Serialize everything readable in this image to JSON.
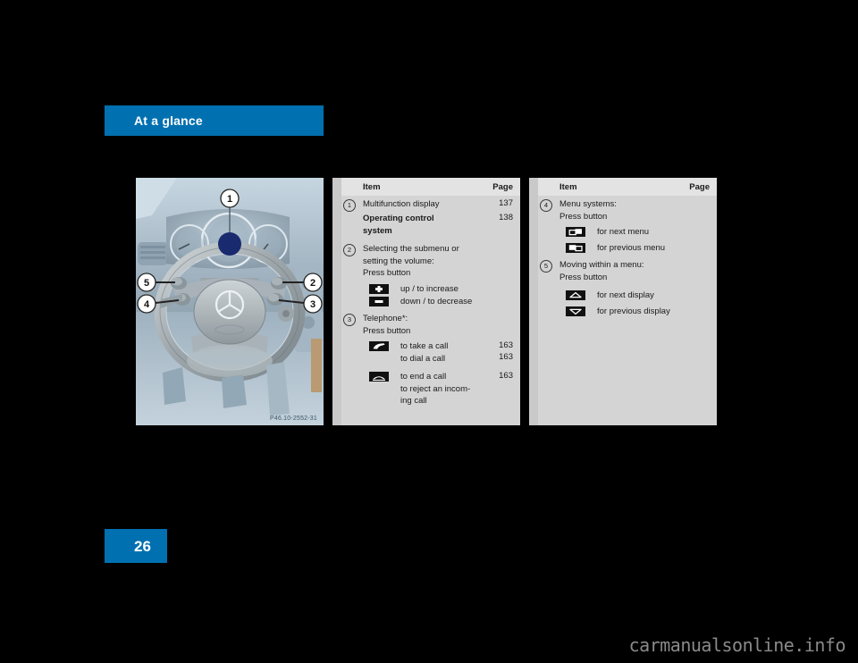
{
  "document": {
    "section_title": "At a glance",
    "page_number": "26",
    "watermark": "carmanualsonline.info"
  },
  "figure": {
    "caption": "P46.10-2552-31",
    "alt_name": "steering-wheel-controls-illustration",
    "callouts": [
      {
        "id": "1",
        "label": "1"
      },
      {
        "id": "2",
        "label": "2"
      },
      {
        "id": "3",
        "label": "3"
      },
      {
        "id": "4",
        "label": "4"
      },
      {
        "id": "5",
        "label": "5"
      }
    ]
  },
  "tables": [
    {
      "name": "reference-table-left",
      "headers": {
        "item": "Item",
        "page": "Page"
      },
      "rows": [
        {
          "marker": "1",
          "text": "Multifunction display",
          "page": "137",
          "bold": false
        },
        {
          "marker": "",
          "text": "Operating control\nsystem",
          "page": "138",
          "bold": true
        },
        {
          "marker": "2",
          "text": "Selecting the submenu or\nsetting the volume:\nPress button",
          "page": "",
          "bold": false
        }
      ],
      "glyph_rows": [
        {
          "icon": "plus-button-icon",
          "label": "up / to increase",
          "page": ""
        },
        {
          "icon": "minus-button-icon",
          "label": "down / to decrease",
          "page": ""
        }
      ],
      "rows2": [
        {
          "marker": "3",
          "text": "Telephone*:\nPress button",
          "page": "",
          "bold": false
        }
      ],
      "glyph_rows2": [
        {
          "icon": "phone-offhook-icon",
          "label": "to take a call\nto dial a call",
          "page": "163",
          "page2": "163"
        },
        {
          "icon": "phone-onhook-icon",
          "label": "to end a call\nto reject an incom-\ning call",
          "page": "163",
          "page2": ""
        }
      ]
    },
    {
      "name": "reference-table-right",
      "headers": {
        "item": "Item",
        "page": "Page"
      },
      "rows": [
        {
          "marker": "4",
          "text": "Menu systems:\nPress button",
          "page": "",
          "bold": false
        }
      ],
      "glyph_rows": [
        {
          "icon": "next-menu-icon",
          "label": "for next menu",
          "page": ""
        },
        {
          "icon": "previous-menu-icon",
          "label": "for previous menu",
          "page": ""
        }
      ],
      "rows2": [
        {
          "marker": "5",
          "text": "Moving within a menu:\nPress button",
          "page": "",
          "bold": false
        }
      ],
      "glyph_rows2": [
        {
          "icon": "up-arrow-button-icon",
          "label": "for next display",
          "page": ""
        },
        {
          "icon": "down-arrow-button-icon",
          "label": "for previous display",
          "page": ""
        }
      ]
    }
  ],
  "colors": {
    "brand_blue": "#0070b0",
    "table_body_gray": "#d4d4d4",
    "table_header_gray": "#e3e3e3",
    "figure_bg": "#b9cad6",
    "callout_dot_navy": "#1a2a6e"
  }
}
